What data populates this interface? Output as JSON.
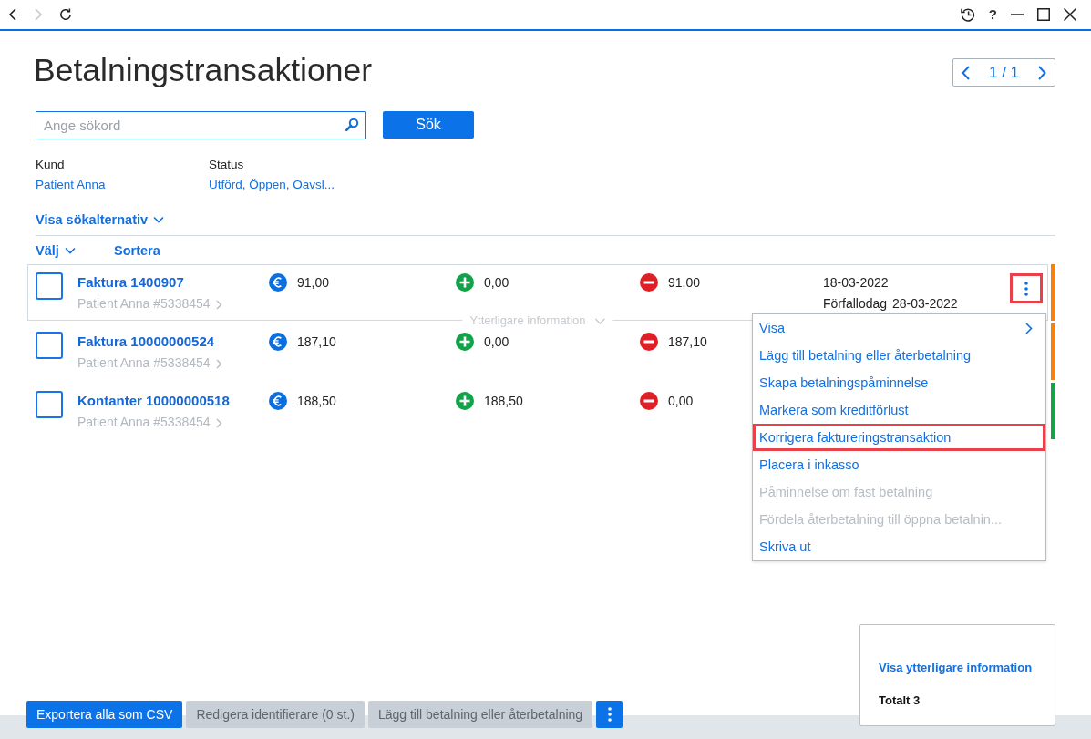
{
  "toolbar": {
    "back_disabled": false,
    "forward_disabled": true,
    "help": "?"
  },
  "page": {
    "title": "Betalningstransaktioner",
    "pager": "1 / 1"
  },
  "search": {
    "placeholder": "Ange sökord",
    "button": "Sök"
  },
  "filters": [
    {
      "label": "Kund",
      "value": "Patient Anna"
    },
    {
      "label": "Status",
      "value": "Utförd, Öppen, Oavsl..."
    }
  ],
  "options_toggle": "Visa sökalternativ",
  "list_header": {
    "select": "Välj",
    "sort": "Sortera"
  },
  "rows": [
    {
      "title": "Faktura 1400907",
      "customer": "Patient Anna #5338454",
      "amount": "91,00",
      "paid": "0,00",
      "remaining": "91,00",
      "date": "18-03-2022",
      "due_label": "Förfallodag",
      "due_date": "28-03-2022",
      "checked": false,
      "focused": true,
      "more_info": "Ytterligare information",
      "menu_button": {
        "highlighted": true
      },
      "color": "#f5820b"
    },
    {
      "title": "Faktura 10000000524",
      "customer": "Patient Anna #5338454",
      "amount": "187,10",
      "paid": "0,00",
      "remaining": "187,10",
      "checked": false,
      "focused": false,
      "color": "#f5820b"
    },
    {
      "title": "Kontanter 10000000518",
      "customer": "Patient Anna #5338454",
      "amount": "188,50",
      "paid": "188,50",
      "remaining": "0,00",
      "checked": false,
      "focused": false,
      "color": "#13a34b"
    }
  ],
  "context_menu": [
    {
      "label": "Visa",
      "submenu": true,
      "disabled": false,
      "highlighted": false
    },
    {
      "label": "Lägg till betalning eller återbetalning",
      "submenu": false,
      "disabled": false,
      "highlighted": false
    },
    {
      "label": "Skapa betalningspåminnelse",
      "submenu": false,
      "disabled": false,
      "highlighted": false
    },
    {
      "label": "Markera som kreditförlust",
      "submenu": false,
      "disabled": false,
      "highlighted": false
    },
    {
      "label": "Korrigera faktureringstransaktion",
      "submenu": false,
      "disabled": false,
      "highlighted": true
    },
    {
      "label": "Placera i inkasso",
      "submenu": false,
      "disabled": false,
      "highlighted": false
    },
    {
      "label": "Påminnelse om fast betalning",
      "submenu": false,
      "disabled": true,
      "highlighted": false
    },
    {
      "label": "Fördela återbetalning till öppna betalnin...",
      "submenu": false,
      "disabled": true,
      "highlighted": false
    },
    {
      "label": "Skriva ut",
      "submenu": false,
      "disabled": false,
      "highlighted": false
    }
  ],
  "action_bar": {
    "buttons": [
      {
        "label": "Exportera alla som CSV",
        "disabled": false
      },
      {
        "label": "Redigera identifierare (0 st.)",
        "disabled": true
      },
      {
        "label": "Lägg till betalning eller återbetalning",
        "disabled": true
      }
    ],
    "more_disabled": false
  },
  "summary": {
    "link": "Visa ytterligare information",
    "total": "Totalt 3"
  }
}
